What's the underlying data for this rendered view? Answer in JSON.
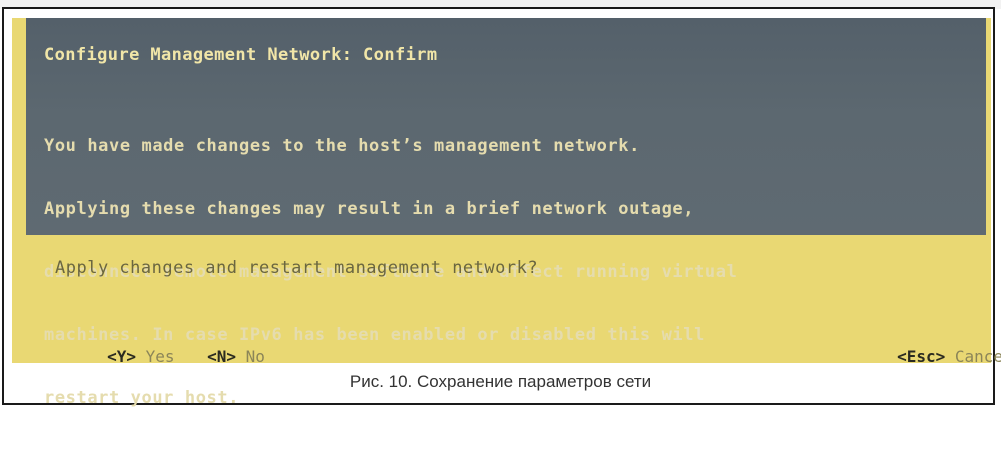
{
  "dialog": {
    "title": "Configure Management Network: Confirm",
    "body_lines": [
      "You have made changes to the host’s management network.",
      "Applying these changes may result in a brief network outage,",
      "disconnect remote management software and affect running virtual",
      "machines. In case IPv6 has been enabled or disabled this will",
      "restart your host."
    ],
    "prompt": "Apply changes and restart management network?"
  },
  "actions": {
    "yes": {
      "key": "<Y>",
      "label": "Yes"
    },
    "no": {
      "key": "<N>",
      "label": "No"
    },
    "cancel": {
      "key": "<Esc>",
      "label": "Cancel"
    }
  },
  "caption": "Рис. 10. Сохранение параметров сети",
  "colors": {
    "header_bg": "#5c6870",
    "screen_bg": "#e9d873",
    "title_text": "#f1e6a8"
  }
}
